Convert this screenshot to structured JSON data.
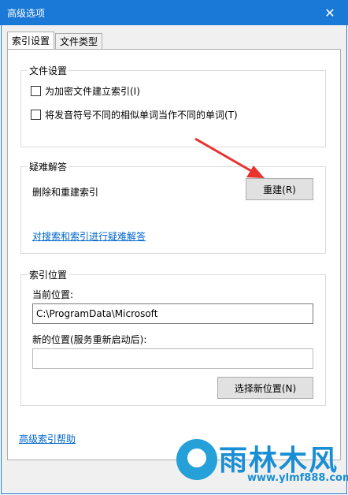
{
  "window": {
    "title": "高级选项",
    "close_glyph": "✕"
  },
  "tabs": [
    {
      "label": "索引设置",
      "active": true
    },
    {
      "label": "文件类型",
      "active": false
    }
  ],
  "file_settings": {
    "legend": "文件设置",
    "checkboxes": [
      {
        "label": "为加密文件建立索引(I)",
        "checked": false
      },
      {
        "label": "将发音符号不同的相似单词当作不同的单词(T)",
        "checked": false
      }
    ]
  },
  "troubleshooting": {
    "legend": "疑难解答",
    "rebuild_text": "删除和重建索引",
    "rebuild_button": "重建(R)",
    "link": "对搜索和索引进行疑难解答"
  },
  "index_location": {
    "legend": "索引位置",
    "current_label": "当前位置:",
    "current_value": "C:\\ProgramData\\Microsoft",
    "new_label": "新的位置(服务重新启动后):",
    "new_value": "",
    "select_button": "选择新位置(N)"
  },
  "help_link": "高级索引帮助",
  "watermark": {
    "brand": "雨林木风",
    "url": "www.ylmf888.com"
  },
  "colors": {
    "titlebar": "#1a78d6",
    "arrow": "#e8322e",
    "link": "#0066cc"
  }
}
